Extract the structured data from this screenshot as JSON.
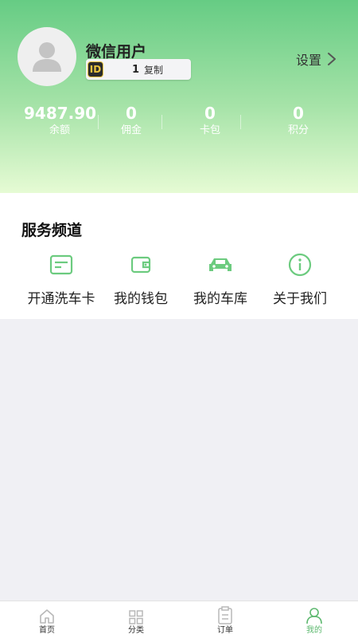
{
  "profile": {
    "username": "微信用户",
    "id_badge": "ID",
    "id_value": "1",
    "copy_label": "复制"
  },
  "settings": {
    "label": "设置"
  },
  "stats": [
    {
      "value": "9487.90",
      "label": "余额"
    },
    {
      "value": "0",
      "label": "佣金"
    },
    {
      "value": "0",
      "label": "卡包"
    },
    {
      "value": "0",
      "label": "积分"
    }
  ],
  "service": {
    "title": "服务频道",
    "items": [
      {
        "label": "开通洗车卡",
        "icon": "card-icon"
      },
      {
        "label": "我的钱包",
        "icon": "wallet-icon"
      },
      {
        "label": "我的车库",
        "icon": "car-icon"
      },
      {
        "label": "关于我们",
        "icon": "info-icon"
      }
    ]
  },
  "tabbar": {
    "active": "我的",
    "items": [
      {
        "label": "首页",
        "icon": "home-icon"
      },
      {
        "label": "分类",
        "icon": "grid-icon"
      },
      {
        "label": "订单",
        "icon": "order-icon"
      },
      {
        "label": "我的",
        "icon": "user-icon"
      }
    ]
  },
  "colors": {
    "accent": "#5cb86e",
    "header_top": "#66cc84",
    "header_bottom": "#e6fbd4"
  }
}
